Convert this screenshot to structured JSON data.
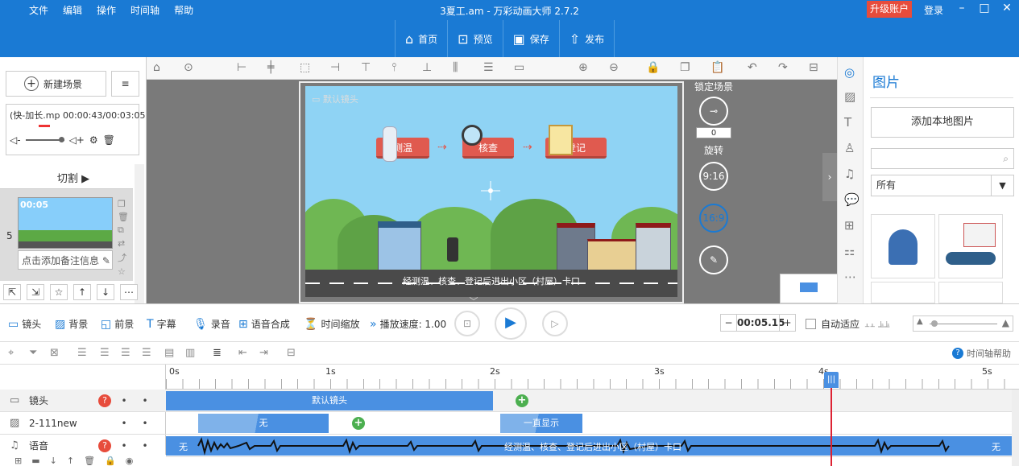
{
  "titlebar": {
    "menus": [
      "文件",
      "编辑",
      "操作",
      "时间轴",
      "帮助"
    ],
    "title": "3夏工.am - 万彩动画大师 2.7.2",
    "upgrade": "升级账户",
    "login": "登录"
  },
  "toolbar": {
    "home": "首页",
    "preview": "预览",
    "save": "保存",
    "publish": "发布"
  },
  "left": {
    "new_scene": "新建场景",
    "audio_name": "(快-加长.mp",
    "audio_time": "00:00:43/00:03:05",
    "cut": "切割",
    "scene_number": "5",
    "thumb_time": "00:05",
    "note_placeholder": "点击添加备注信息"
  },
  "stage": {
    "default_camera": "默认镜头",
    "steps": [
      "测温",
      "核查",
      "登记"
    ],
    "caption": "经测温、核查、登记后进出小区（村屋）卡口"
  },
  "stage_controls": {
    "lock_scene": "锁定场景",
    "rotation_value": "0",
    "rotate": "旋转",
    "ratio_a": "9:16",
    "ratio_b": "16:9"
  },
  "right_panel": {
    "title": "图片",
    "add_local": "添加本地图片",
    "filter": "所有"
  },
  "timeline_toolbar": {
    "camera": "镜头",
    "background": "背景",
    "foreground": "前景",
    "subtitle": "字幕",
    "record": "录音",
    "tts": "语音合成",
    "time_scale": "时间缩放",
    "speed": "播放速度: 1.00",
    "current_time": "00:05.15",
    "auto_fit": "自动适应",
    "help": "时间轴帮助"
  },
  "ruler": [
    "0s",
    "1s",
    "2s",
    "3s",
    "4s",
    "5s"
  ],
  "tracks": [
    {
      "name": "镜头",
      "icon": "camera-icon",
      "warn": "?"
    },
    {
      "name": "2-111new",
      "icon": "image-icon",
      "warn": ""
    },
    {
      "name": "语音",
      "icon": "music-icon",
      "warn": "?"
    }
  ],
  "clips": {
    "camera_default": "默认镜头",
    "none": "无",
    "always_show": "一直显示",
    "voice_start": "无",
    "voice_caption": "经测温、核查、登记后进出小区（村屋）卡口",
    "voice_end": "无"
  },
  "colors": {
    "brand": "#1a7ad4",
    "step": "#e05a4f",
    "clip": "#4a90e2",
    "playhead": "#dd2233"
  }
}
